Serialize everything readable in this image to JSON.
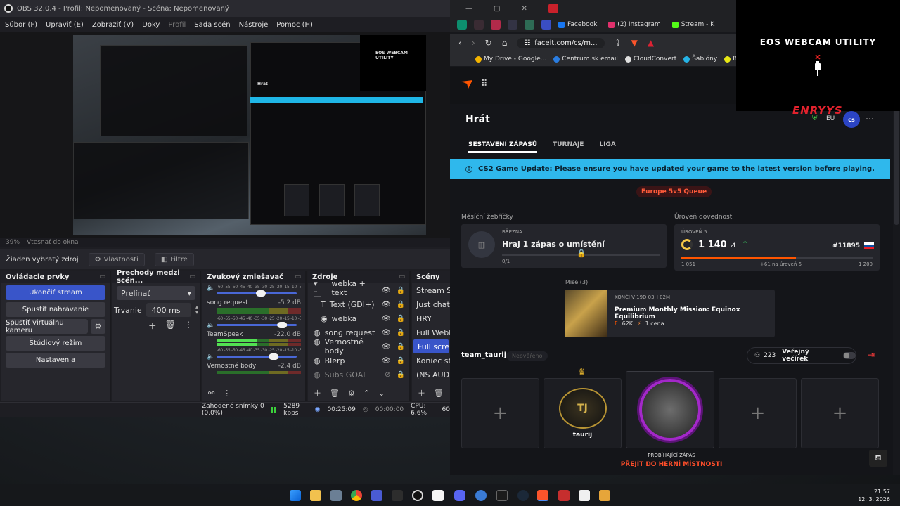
{
  "obs": {
    "title": "OBS 32.0.4 - Profil: Nepomenovaný - Scéna: Nepomenovaný",
    "menu": [
      "Súbor (F)",
      "Upraviť (E)",
      "Zobraziť (V)",
      "Doky",
      "Profil",
      "Sada scén",
      "Nástroje",
      "Pomoc (H)"
    ],
    "zoom": "39%",
    "fit": "Vtesnať do okna",
    "no_source": "Žiaden vybratý zdroj",
    "properties": "Vlastnosti",
    "filters": "Filtre",
    "controls": {
      "header": "Ovládacie prvky",
      "stop_stream": "Ukončiť stream",
      "start_recording": "Spustiť nahrávanie",
      "start_virtualcam": "Spustiť virtuálnu kameru",
      "studio_mode": "Štúdiový režim",
      "settings": "Nastavenia"
    },
    "transitions": {
      "header": "Prechody medzi scén...",
      "selected": "Prelínať",
      "duration_label": "Trvanie",
      "duration": "400 ms"
    },
    "mixer": {
      "header": "Zvukový zmiešavač",
      "ticks": "-60 -55 -50 -45 -40 -35 -30 -25 -20 -15 -10 -5 -0",
      "channels": [
        {
          "name": "song request",
          "db": "-5.2 dB",
          "level": 0.0,
          "volume": 0.8
        },
        {
          "name": "TeamSpeak",
          "db": "-22.0 dB",
          "level": 0.48,
          "volume": 0.7
        },
        {
          "name": "Vernostné body",
          "db": "-2.4 dB",
          "level": 0.0,
          "volume": 0.85
        }
      ]
    },
    "sources": {
      "header": "Zdroje",
      "items": [
        {
          "name": "webka + text",
          "icon": "folder-icon",
          "indent": false,
          "enabled": true
        },
        {
          "name": "Text (GDI+)",
          "icon": "text-icon",
          "indent": true,
          "enabled": true
        },
        {
          "name": "webka",
          "icon": "camera-icon",
          "indent": true,
          "enabled": true
        },
        {
          "name": "song request",
          "icon": "globe-icon",
          "indent": false,
          "enabled": true
        },
        {
          "name": "Vernostné body",
          "icon": "globe-icon",
          "indent": false,
          "enabled": true
        },
        {
          "name": "Blerp",
          "icon": "globe-icon",
          "indent": false,
          "enabled": true
        },
        {
          "name": "Subs GOAL",
          "icon": "globe-icon",
          "indent": false,
          "enabled": false
        }
      ]
    },
    "scenes": {
      "header": "Scény",
      "items": [
        "Stream Star",
        "Just chattin",
        "HRY",
        "Full Webka",
        "Full screen",
        "Koniec stre",
        "(NS AUDIO"
      ],
      "selected_index": 4
    },
    "status": {
      "dropped": "Zahodené snímky 0 (0.0%)",
      "bitrate": "5289 kbps",
      "stream_time": "00:25:09",
      "rec_time": "00:00:00",
      "cpu": "CPU: 6.6%",
      "fps": "60"
    }
  },
  "browser": {
    "tabs": [
      {
        "label": "Facebook",
        "color": "#1877f2"
      },
      {
        "label": "(2) Instagram",
        "color": "#e1306c"
      },
      {
        "label": "Stream - K",
        "color": "#53fc18"
      }
    ],
    "url": "faceit.com/cs/m...",
    "bookmarks": [
      {
        "label": "My Drive - Google...",
        "color": "#f4b400"
      },
      {
        "label": "Centrum.sk email",
        "color": "#2a7de1"
      },
      {
        "label": "CloudConvert",
        "color": "#e0e0e0"
      },
      {
        "label": "Šablóny",
        "color": "#26b3e6"
      },
      {
        "label": "BLAST.tv F",
        "color": "#e8e815"
      }
    ]
  },
  "faceit": {
    "page_title": "Hrát",
    "region": "EU",
    "nav": [
      "SESTAVENÍ ZÁPASŮ",
      "TURNAJE",
      "LIGA"
    ],
    "banner": "CS2 Game Update: Please ensure you have updated your game to the latest version before playing.",
    "queue": "Europe 5v5 Queue",
    "monthly_label": "Měsíční žebříčky",
    "monthly_month": "BŘEZNA",
    "monthly_task": "Hraj 1 zápas o umístění",
    "monthly_progress": "0/1",
    "skill_label": "Úroveň dovednosti",
    "skill_level": "ÚROVEŇ 5",
    "elo": "1 140",
    "rank": "#11895",
    "elo_min": "1 051",
    "elo_next": "+61 na úroveň 6",
    "elo_max": "1 200",
    "elo_progress": 0.6,
    "missions_label": "Mise (3)",
    "mission_ends": "KONČÍ V 19D 03H 02M",
    "mission_name": "Premium Monthly Mission: Equinox Equilibrium",
    "mission_points": "62K",
    "mission_reward": "1 cena",
    "team_name": "team_taurij",
    "team_status": "Neověřeno",
    "party_count": "223",
    "party_label": "Veřejný večírek",
    "player_name": "taurij",
    "match_status": "PROBÍHAJÍCÍ ZÁPAS",
    "match_link": "PŘEJÍT DO HERNÍ MÍSTNOSTI"
  },
  "webcam": {
    "title": "EOS WEBCAM UTILITY",
    "watermark": "ENRYYS"
  },
  "taskbar": {
    "time": "21:57",
    "date": "12. 3. 2026"
  }
}
